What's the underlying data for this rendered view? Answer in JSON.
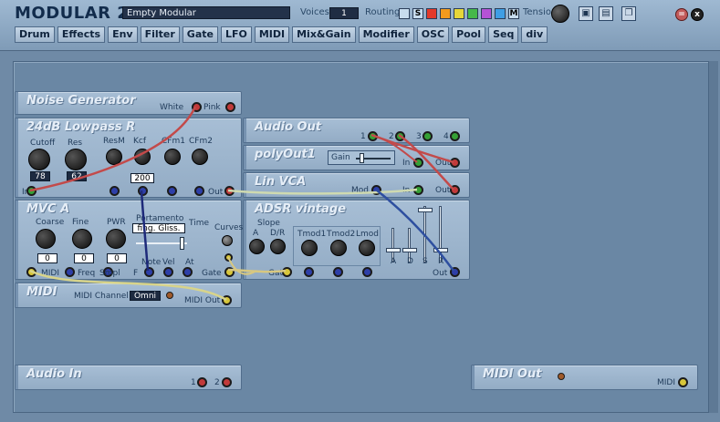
{
  "app": {
    "title": "MODULAR 2",
    "patch_name": "Empty Modular",
    "voices_label": "Voices",
    "voices_value": "1",
    "routing_label": "Routing",
    "routing_swatches": [
      {
        "label": "",
        "color": "#c7dcee"
      },
      {
        "label": "S",
        "color": "#c7dcee"
      },
      {
        "label": "",
        "color": "#e33a2a"
      },
      {
        "label": "",
        "color": "#f29a1e"
      },
      {
        "label": "",
        "color": "#e6d63a"
      },
      {
        "label": "",
        "color": "#46b84a"
      },
      {
        "label": "",
        "color": "#b552d6"
      },
      {
        "label": "",
        "color": "#3f9ee4"
      },
      {
        "label": "M",
        "color": "#c7dcee"
      }
    ],
    "tension_label": "Tension",
    "close_label": "x",
    "min_label": "="
  },
  "menu": [
    "Drum",
    "Effects",
    "Env",
    "Filter",
    "Gate",
    "LFO",
    "MIDI",
    "Mix&Gain",
    "Modifier",
    "OSC",
    "Pool",
    "Seq",
    "div"
  ],
  "modules": {
    "noise": {
      "title": "Noise Generator",
      "white": "White",
      "pink": "Pink"
    },
    "lowpass": {
      "title": "24dB Lowpass R",
      "cutoff": "Cutoff",
      "res": "Res",
      "resm": "ResM",
      "kcf": "Kcf",
      "cfm1": "CFm1",
      "cfm2": "CFm2",
      "cutoff_val": "78",
      "res_val": "62",
      "kcf_val": "200",
      "in": "In",
      "out": "Out"
    },
    "audio_out": {
      "title": "Audio Out",
      "p1": "1",
      "p2": "2",
      "p3": "3",
      "p4": "4"
    },
    "polyout": {
      "title": "polyOut1",
      "gain": "Gain",
      "in": "In",
      "out": "Out"
    },
    "linvca": {
      "title": "Lin VCA",
      "mod": "Mod",
      "in": "In",
      "out": "Out"
    },
    "mvca": {
      "title": "MVC A",
      "coarse": "Coarse",
      "fine": "Fine",
      "pwr": "PWR",
      "portamento": "Portamento",
      "porta_mode": "fing. Gliss.",
      "time": "Time",
      "curves": "Curves",
      "coarse_val": "0",
      "fine_val": "0",
      "pwr_val": "0",
      "midi": "MIDI",
      "freq": "Freq",
      "smpl": "Smpl",
      "f": "F",
      "note": "Note",
      "vel": "Vel",
      "at": "At",
      "gate": "Gate"
    },
    "adsr": {
      "title": "ADSR vintage",
      "slope": "Slope",
      "a": "A",
      "dr": "D/R",
      "tmod1": "Tmod1",
      "tmod2": "Tmod2",
      "lmod": "Lmod",
      "gate": "Gate",
      "sa": "A",
      "sd": "D",
      "ss": "S",
      "sr": "R",
      "out": "Out"
    },
    "midi": {
      "title": "MIDI",
      "channel_label": "MIDI Channel",
      "channel_val": "Omni",
      "midi_out": "MIDI Out"
    },
    "audio_in": {
      "title": "Audio In",
      "p1": "1",
      "p2": "2"
    },
    "midi_out": {
      "title": "MIDI Out",
      "midi": "MIDI"
    }
  }
}
